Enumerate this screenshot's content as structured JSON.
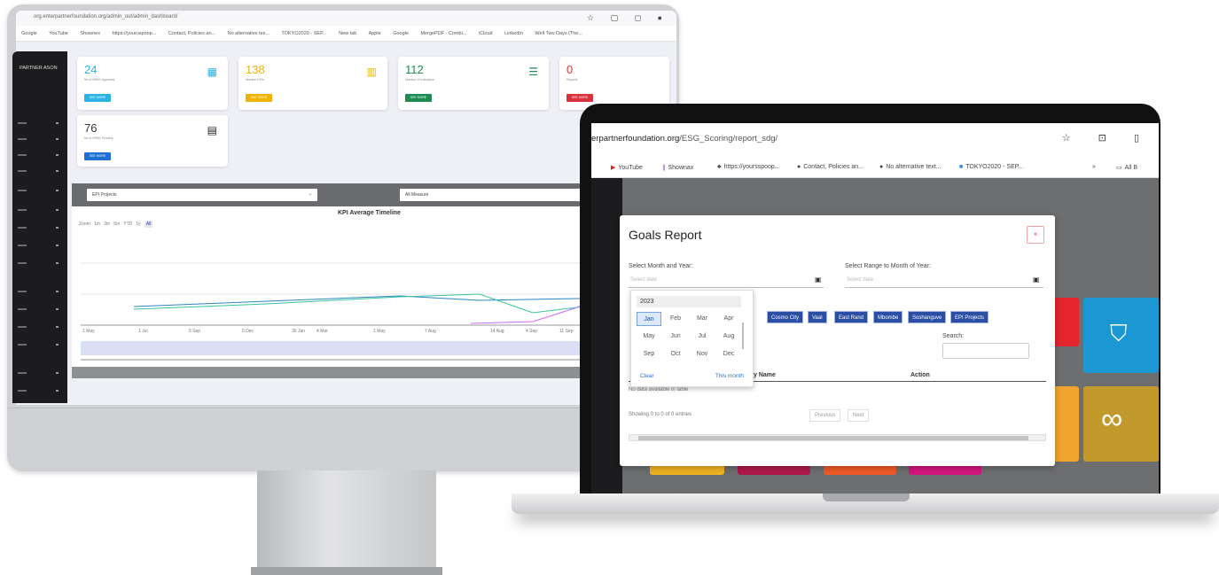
{
  "monitor": {
    "url": "org.enterpartnerfoundation.org/admin_out/admin_dashboard/",
    "bookmarks": [
      "Google",
      "YouTube",
      "Shownex",
      "https://youruspoop...",
      "Contact, Policies an...",
      "No alternative tex...",
      "TOKYO2020 - SEP...",
      "New tab",
      "Apple",
      "Google",
      "MergePDF - Combi...",
      "iCloud",
      "LinkedIn",
      "Well Two Days (The..."
    ],
    "logo": "PARTNER ASON",
    "cards": [
      {
        "num": "24",
        "sub": "No of NPAS Approved",
        "btn": "SEE MORE",
        "color": "#2bb3e6",
        "btncolor": "#2bb3e6",
        "icon": "building-icon"
      },
      {
        "num": "138",
        "sub": "Number KPIs",
        "btn": "SEE MORE",
        "color": "#f0b400",
        "btncolor": "#f0b400",
        "icon": "bar-chart-icon"
      },
      {
        "num": "112",
        "sub": "Number of Indicators",
        "btn": "SEE MORE",
        "color": "#1e8a54",
        "btncolor": "#1e8a54",
        "icon": "list-icon"
      },
      {
        "num": "0",
        "sub": "Reports",
        "btn": "SEE MORE",
        "color": "#d9323d",
        "btncolor": "#d9323d",
        "icon": "alert-icon"
      },
      {
        "num": "76",
        "sub": "No of NPAS Pending",
        "btn": "SEE MORE",
        "color": "#333333",
        "btncolor": "#1f6fd6",
        "icon": "document-icon"
      }
    ],
    "chart": {
      "select_left": "EPI Projects",
      "select_right": "All Measure",
      "title": "KPI Average Timeline",
      "zoom_label": "Zoom",
      "zoom_opts": [
        "1m",
        "3m",
        "6m",
        "YTD",
        "1y",
        "All"
      ],
      "x_ticks": [
        "1 May",
        "1 Jul",
        "5 Sep",
        "5 Dec",
        "30 Jan",
        "4 Mar",
        "1 May",
        "7 Aug",
        "14 Aug",
        "4 Sep",
        "11 Sep"
      ]
    }
  },
  "laptop": {
    "url_prefix": "erpartnerfoundation.org",
    "url_path": "/ESG_Scoring/report_sdg/",
    "bookmarks": [
      "YouTube",
      "Shownax",
      "https://yoursspoop...",
      "Contact, Policies an...",
      "No alternative text...",
      "TOKYO2020 - SEP..."
    ],
    "all_bookmarks": "All B",
    "modal": {
      "title": "Goals Report",
      "close": "×",
      "label_month": "Select Month and Year:",
      "label_range": "Select Range to Month of Year:",
      "placeholder_month": "Select date",
      "placeholder_range": "Select date",
      "chips": [
        "Cosmo City",
        "Vaal",
        "East Rand",
        "Mbombe",
        "Soshanguve",
        "EPI Projects"
      ],
      "search_label": "Search:",
      "col_name": "y Name",
      "col_action": "Action",
      "empty": "No data available in table",
      "showing": "Showing 0 to 0 of 0 entries",
      "prev": "Previous",
      "next": "Next"
    },
    "picker": {
      "year": "2023",
      "months": [
        "Jan",
        "Feb",
        "Mar",
        "Apr",
        "May",
        "Jun",
        "Jul",
        "Aug",
        "Sep",
        "Oct",
        "Nov",
        "Dec"
      ],
      "selected": "Jan",
      "clear": "Clear",
      "this_month": "This month"
    }
  }
}
